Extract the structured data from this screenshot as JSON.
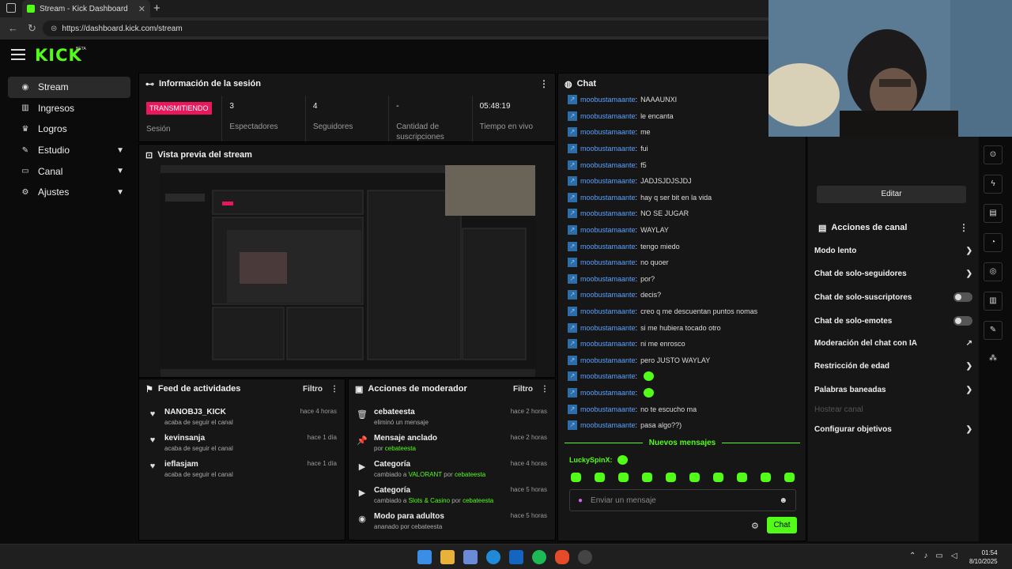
{
  "browser": {
    "tab_title": "Stream - Kick Dashboard",
    "url": "https://dashboard.kick.com/stream"
  },
  "app": {
    "logo": "KICK",
    "logo_badge": "BETA",
    "accent": "#53fc18"
  },
  "sidebar": {
    "items": [
      {
        "label": "Stream",
        "icon": "broadcast-icon",
        "active": true
      },
      {
        "label": "Ingresos",
        "icon": "chart-icon"
      },
      {
        "label": "Logros",
        "icon": "trophy-icon"
      },
      {
        "label": "Estudio",
        "icon": "studio-icon",
        "expandable": true
      },
      {
        "label": "Canal",
        "icon": "channel-icon",
        "expandable": true
      },
      {
        "label": "Ajustes",
        "icon": "gear-icon",
        "expandable": true
      }
    ]
  },
  "session": {
    "title": "Información de la sesión",
    "status_badge": "TRANSMITIENDO",
    "status_label": "Sesión",
    "viewers_value": "3",
    "viewers_label": "Espectadores",
    "followers_value": "4",
    "followers_label": "Seguidores",
    "subs_value": "-",
    "subs_label": "Cantidad de suscripciones",
    "uptime_value": "05:48:19",
    "uptime_label": "Tiempo en vivo"
  },
  "preview": {
    "title": "Vista previa del stream"
  },
  "activity": {
    "title": "Feed de actividades",
    "filter": "Filtro",
    "items": [
      {
        "name": "NANOBJ3_KICK",
        "desc": "acaba de seguir el canal",
        "time": "hace 4 horas"
      },
      {
        "name": "kevinsanja",
        "desc": "acaba de seguir el canal",
        "time": "hace 1 día"
      },
      {
        "name": "ieflasjam",
        "desc": "acaba de seguir el canal",
        "time": "hace 1 día"
      }
    ]
  },
  "moderator": {
    "title": "Acciones de moderador",
    "filter": "Filtro",
    "items": [
      {
        "title": "cebateesta",
        "desc": "eliminó un mensaje",
        "time": "hace 2 horas",
        "icon": "trash-icon"
      },
      {
        "title": "Mensaje anclado",
        "desc": "por ",
        "hl": "cebateesta",
        "time": "hace 2 horas",
        "icon": "pin-icon"
      },
      {
        "title": "Categoría",
        "desc": "cambiado a ",
        "hl": "VALORANT",
        "desc2": " por ",
        "hl2": "cebateesta",
        "time": "hace 4 horas",
        "icon": "category-icon"
      },
      {
        "title": "Categoría",
        "desc": "cambiado a ",
        "hl": "Slots & Casino",
        "desc2": " por ",
        "hl2": "cebateesta",
        "time": "hace 5 horas",
        "icon": "category-icon"
      },
      {
        "title": "Modo para adultos",
        "desc": "ananado por cebateesta",
        "time": "hace 5 horas",
        "icon": "eye-icon"
      }
    ]
  },
  "chat": {
    "title": "Chat",
    "user": "moobustamaante",
    "messages": [
      "NAAAUNXI",
      "le encanta",
      "me",
      "fui",
      "f5",
      "JADJSJDJSJDJ",
      "hay q ser bit en la vida",
      "NO SE JUGAR",
      "WAYLAY",
      "tengo miedo",
      "no quoer",
      "por?",
      "decis?",
      "creo q me descuentan puntos nomas",
      "si me hubiera tocado otro",
      "ni me enrosco",
      "pero JUSTO WAYLAY",
      "",
      "",
      "no te escucho ma",
      "pasa algo??)"
    ],
    "new_messages": "Nuevos mensajes",
    "last_user": "LuckySpinX:",
    "input_placeholder": "Enviar un mensaje",
    "send_label": "Chat"
  },
  "channel": {
    "edit_label": "Editar",
    "actions_title": "Acciones de canal",
    "actions": [
      {
        "label": "Modo lento",
        "kind": "arrow"
      },
      {
        "label": "Chat de solo-seguidores",
        "kind": "arrow"
      },
      {
        "label": "Chat de solo-suscriptores",
        "kind": "toggle"
      },
      {
        "label": "Chat de solo-emotes",
        "kind": "toggle"
      },
      {
        "label": "Moderación del chat con IA",
        "kind": "external"
      },
      {
        "label": "Restricción de edad",
        "kind": "arrow"
      },
      {
        "label": "Palabras baneadas",
        "kind": "arrow"
      },
      {
        "label": "Hostear canal",
        "kind": "disabled"
      },
      {
        "label": "Configurar objetivos",
        "kind": "arrow"
      }
    ]
  },
  "taskbar": {
    "time": "01:54",
    "date": "8/10/2025"
  }
}
